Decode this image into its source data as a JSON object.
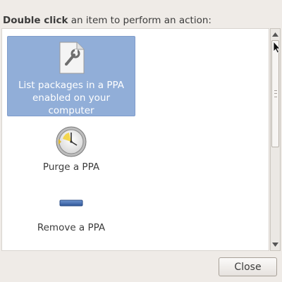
{
  "instruction": {
    "bold": "Double click",
    "rest": " an item to perform an action:"
  },
  "items": [
    {
      "label": "List packages in a PPA enabled on your computer",
      "icon": "document-wrench-icon",
      "selected": true
    },
    {
      "label": "Purge a PPA",
      "icon": "clock-icon",
      "selected": false
    },
    {
      "label": "Remove a PPA",
      "icon": "minus-icon",
      "selected": false
    }
  ],
  "buttons": {
    "close": "Close"
  },
  "colors": {
    "selection": "#91aed8",
    "background": "#efebe7"
  }
}
